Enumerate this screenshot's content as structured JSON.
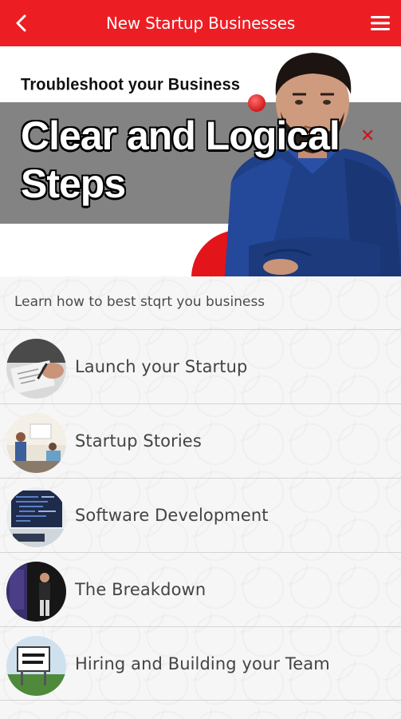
{
  "header": {
    "title": "New Startup Businesses",
    "back_icon": "chevron-left-icon",
    "menu_icon": "hamburger-menu-icon",
    "background_color": "#ec1e24"
  },
  "hero": {
    "kicker": "Troubleshoot your Business",
    "headline": "Clear and Logical Steps",
    "accent_color": "#e3151b"
  },
  "intro_text": "Learn how to best stqrt you business",
  "items": [
    {
      "label": "Launch your Startup",
      "thumb": "hand-writing-photo"
    },
    {
      "label": "Startup Stories",
      "thumb": "team-meeting-photo"
    },
    {
      "label": "Software Development",
      "thumb": "code-screen-photo"
    },
    {
      "label": "The Breakdown",
      "thumb": "speaker-on-stage-photo"
    },
    {
      "label": "Hiring and Building your Team",
      "thumb": "now-hiring-sign-photo"
    }
  ]
}
